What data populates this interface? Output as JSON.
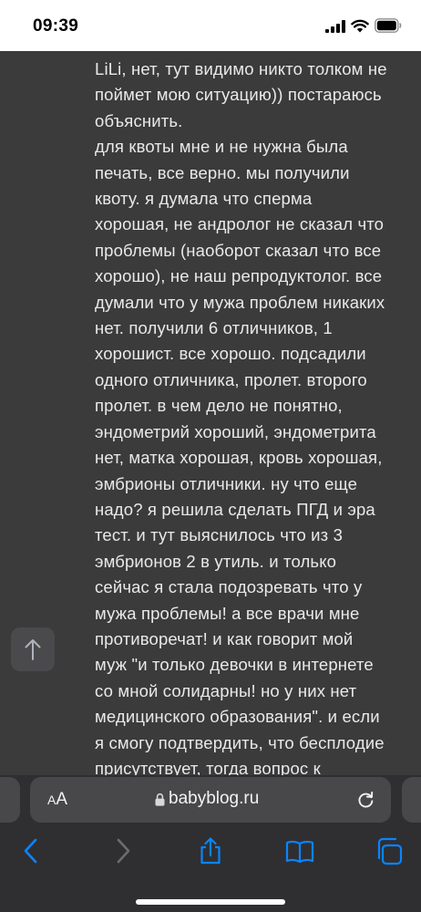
{
  "status_bar": {
    "time": "09:39"
  },
  "post": {
    "lines": [
      "LiLi, нет, тут видимо никто толком не",
      "поймет мою ситуацию)) постараюсь",
      "объяснить.",
      "для квоты мне и не нужна была",
      "печать, все верно. мы получили",
      "квоту. я думала что сперма",
      "хорошая, не андролог не сказал что",
      "проблемы (наоборот сказал что все",
      "хорошо), не наш репродуктолог. все",
      "думали что у мужа проблем никаких",
      "нет. получили 6 отличников, 1",
      "хорошист. все хорошо. подсадили",
      "одного отличника, пролет. второго",
      "пролет. в чем дело не понятно,",
      "эндометрий хороший, эндометрита",
      "нет, матка хорошая, кровь хорошая,",
      "эмбрионы отличники. ну что еще",
      "надо? я решила сделать ПГД и эра",
      "тест. и тут выяснилось что из 3",
      "эмбрионов 2 в утиль. и только",
      "сейчас я стала подозревать что у",
      "мужа проблемы! а все врачи мне",
      "противоречат! и как говорит мой",
      "муж \"и только девочки в интернете",
      "со мной солидарны! но у них нет",
      "медицинского образования\". и если",
      "я смогу подтвердить, что бесплодие",
      "присутствует, тогда вопрос к"
    ]
  },
  "address_bar": {
    "aa_small": "A",
    "aa_large": "A",
    "domain": "babyblog.ru"
  },
  "colors": {
    "page_bg": "#3b3b3c",
    "text": "#e9e9e9",
    "toolbar_accent": "#0a84ff",
    "disabled": "#6c6c70"
  },
  "icons": {
    "scroll_top": "arrow-up-icon",
    "toolbar": [
      "back-icon",
      "forward-icon",
      "share-icon",
      "bookmarks-icon",
      "tabs-icon"
    ]
  }
}
